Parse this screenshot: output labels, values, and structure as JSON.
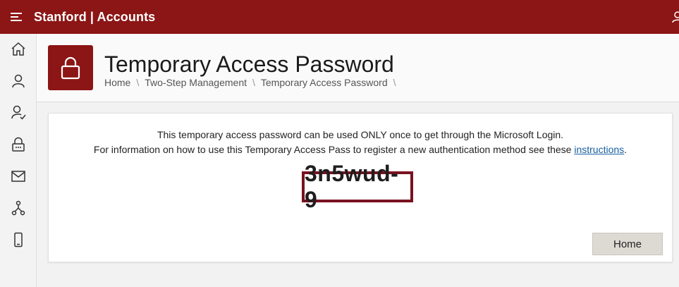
{
  "app": {
    "title": "Stanford | Accounts"
  },
  "icons": {
    "menu": "hamburger-menu-icon",
    "user": "user-icon",
    "lock": "lock-icon"
  },
  "sidebar": {
    "items": [
      {
        "name": "home",
        "icon": "home-icon"
      },
      {
        "name": "profile",
        "icon": "person-icon"
      },
      {
        "name": "account-verification",
        "icon": "person-check-icon"
      },
      {
        "name": "security",
        "icon": "lock-icon"
      },
      {
        "name": "email",
        "icon": "mail-icon"
      },
      {
        "name": "organization",
        "icon": "org-chart-icon"
      },
      {
        "name": "devices",
        "icon": "phone-icon"
      }
    ]
  },
  "page": {
    "title": "Temporary Access Password",
    "breadcrumb": [
      "Home",
      "Two-Step Management",
      "Temporary Access Password"
    ],
    "separator": "\\"
  },
  "card": {
    "line1": "This temporary access password can be used ONLY once to get through the Microsoft Login.",
    "line2_prefix": "For information on how to use this Temporary Access Pass to register a new authentication method see these ",
    "link_text": "instructions",
    "line2_suffix": ".",
    "code": "3n5wud-9",
    "home_button": "Home"
  },
  "colors": {
    "brand": "#8c1515",
    "code_border": "#7a1220",
    "link": "#175e9e",
    "button": "#dcdad3"
  }
}
